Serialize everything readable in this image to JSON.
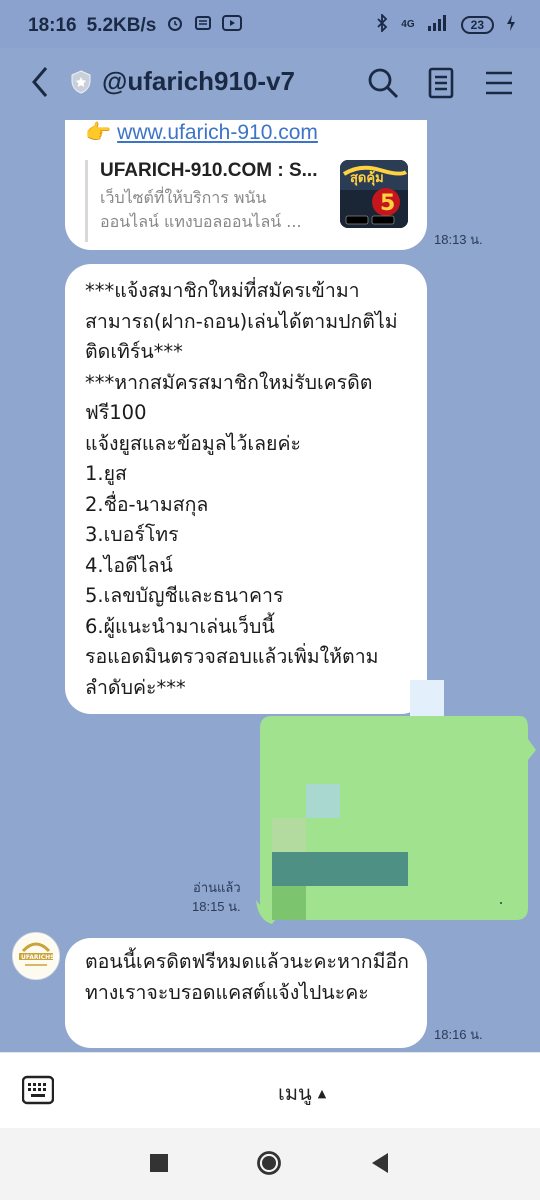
{
  "status": {
    "time": "18:16",
    "speed": "5.2KB/s",
    "network": "4G",
    "battery": "23"
  },
  "header": {
    "title": "@ufarich910-v7",
    "icons": [
      "back-arrow-icon",
      "shield-star-icon",
      "search-icon",
      "notes-icon",
      "menu-icon"
    ]
  },
  "messages": {
    "m1": {
      "emoji": "👉",
      "link": "www.ufarich-910.com",
      "preview_title": "UFARICH-910.COM : S...",
      "preview_desc": "เว็บไซต์ที่ให้บริการ พนันออนไลน์ แทงบอลออนไลน์ ...",
      "time": "18:13 น."
    },
    "m2": {
      "text": "***แจ้งสมาชิกใหม่ที่สมัครเข้ามาสามารถ(ฝาก-ถอน)เล่นได้ตามปกติไม่ติดเทิร์น***\n***หากสมัครสมาชิกใหม่รับเครดิตฟรี100\nแจ้งยูสและข้อมูลไว้เลยค่ะ\n1.ยูส\n2.ชื่อ-นามสกุล\n3.เบอร์โทร\n4.ไอดีไลน์\n5.เลขบัญชีและธนาคาร\n6.ผู้แนะนำมาเล่นเว็บนี้\nรอแอดมินตรวจสอบแล้วเพิ่มให้ตามลำดับค่ะ***"
    },
    "m_user": {
      "read": "อ่านแล้ว",
      "time": "18:15 น."
    },
    "m3": {
      "text": "ตอนนี้เครดิตฟรีหมดแล้วนะคะหากมีอีกทางเราจะบรอดแคสต์แจ้งไปนะคะ",
      "time": "18:16 น."
    }
  },
  "menubar": {
    "label": "เมนู",
    "arrow": "▲"
  },
  "colors": {
    "chat_bg": "#8fa6cf",
    "user_bubble": "#a0e28e",
    "link": "#3d74c9"
  }
}
